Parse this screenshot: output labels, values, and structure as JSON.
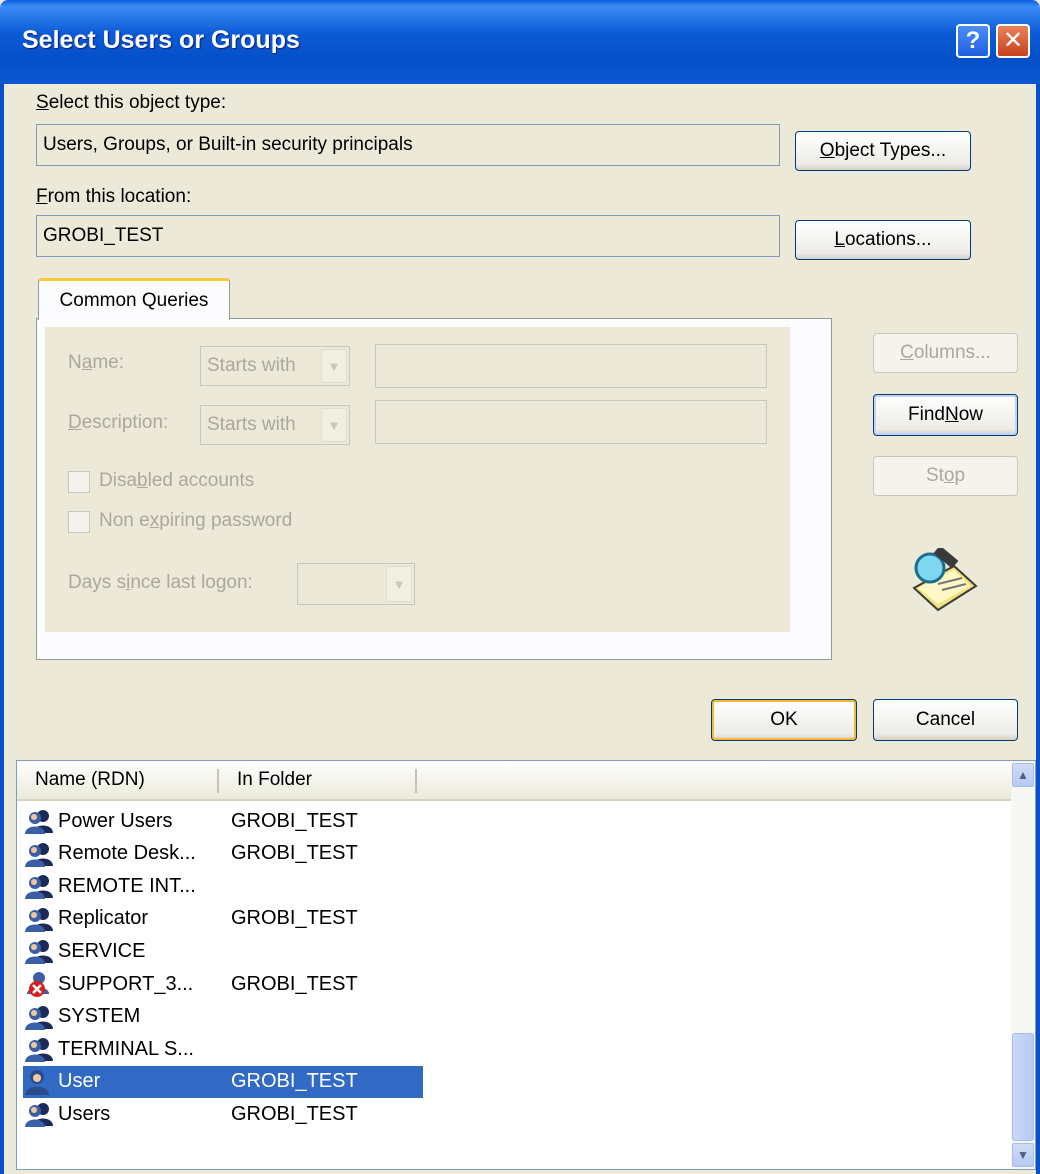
{
  "window": {
    "title": "Select Users or Groups",
    "help_glyph": "?",
    "close_glyph": "✕"
  },
  "object_type": {
    "label_prefix": "S",
    "label_rest": "elect this object type:",
    "value": "Users, Groups, or Built-in security principals",
    "button_prefix": "O",
    "button_rest": "bject Types..."
  },
  "location": {
    "label_prefix": "F",
    "label_rest": "rom this location:",
    "value": "GROBI_TEST",
    "button_prefix": "L",
    "button_rest": "ocations..."
  },
  "query": {
    "tab_label": "Common Queries",
    "name_label_a": "N",
    "name_label_b": "a",
    "name_label_c": "me:",
    "name_mode": "Starts with",
    "description_label_a": "D",
    "description_label_b": "escription:",
    "description_mode": "Starts with",
    "disabled_a": "Disa",
    "disabled_u": "b",
    "disabled_b": "led accounts",
    "nonexp_a": "Non e",
    "nonexp_u": "x",
    "nonexp_b": "piring password",
    "days_a": "Days s",
    "days_u": "i",
    "days_b": "nce last logon:"
  },
  "side_buttons": {
    "columns_u": "C",
    "columns_rest": "olumns...",
    "find_a": "Find ",
    "find_u": "N",
    "find_b": "ow",
    "stop_a": "St",
    "stop_u": "o",
    "stop_b": "p"
  },
  "dialog_buttons": {
    "ok": "OK",
    "cancel": "Cancel"
  },
  "results": {
    "columns": [
      "Name (RDN)",
      "In Folder"
    ],
    "rows": [
      {
        "name": "Power Users",
        "folder": "GROBI_TEST",
        "icon": "group-icon"
      },
      {
        "name": "Remote Desk...",
        "folder": "GROBI_TEST",
        "icon": "group-icon"
      },
      {
        "name": "REMOTE INT...",
        "folder": "",
        "icon": "group-icon"
      },
      {
        "name": "Replicator",
        "folder": "GROBI_TEST",
        "icon": "group-icon"
      },
      {
        "name": "SERVICE",
        "folder": "",
        "icon": "group-icon"
      },
      {
        "name": "SUPPORT_3...",
        "folder": "GROBI_TEST",
        "icon": "disabled-user-icon"
      },
      {
        "name": "SYSTEM",
        "folder": "",
        "icon": "group-icon"
      },
      {
        "name": "TERMINAL S...",
        "folder": "",
        "icon": "group-icon"
      },
      {
        "name": "User",
        "folder": "GROBI_TEST",
        "icon": "user-icon",
        "selected": true
      },
      {
        "name": "Users",
        "folder": "GROBI_TEST",
        "icon": "group-icon"
      }
    ]
  }
}
